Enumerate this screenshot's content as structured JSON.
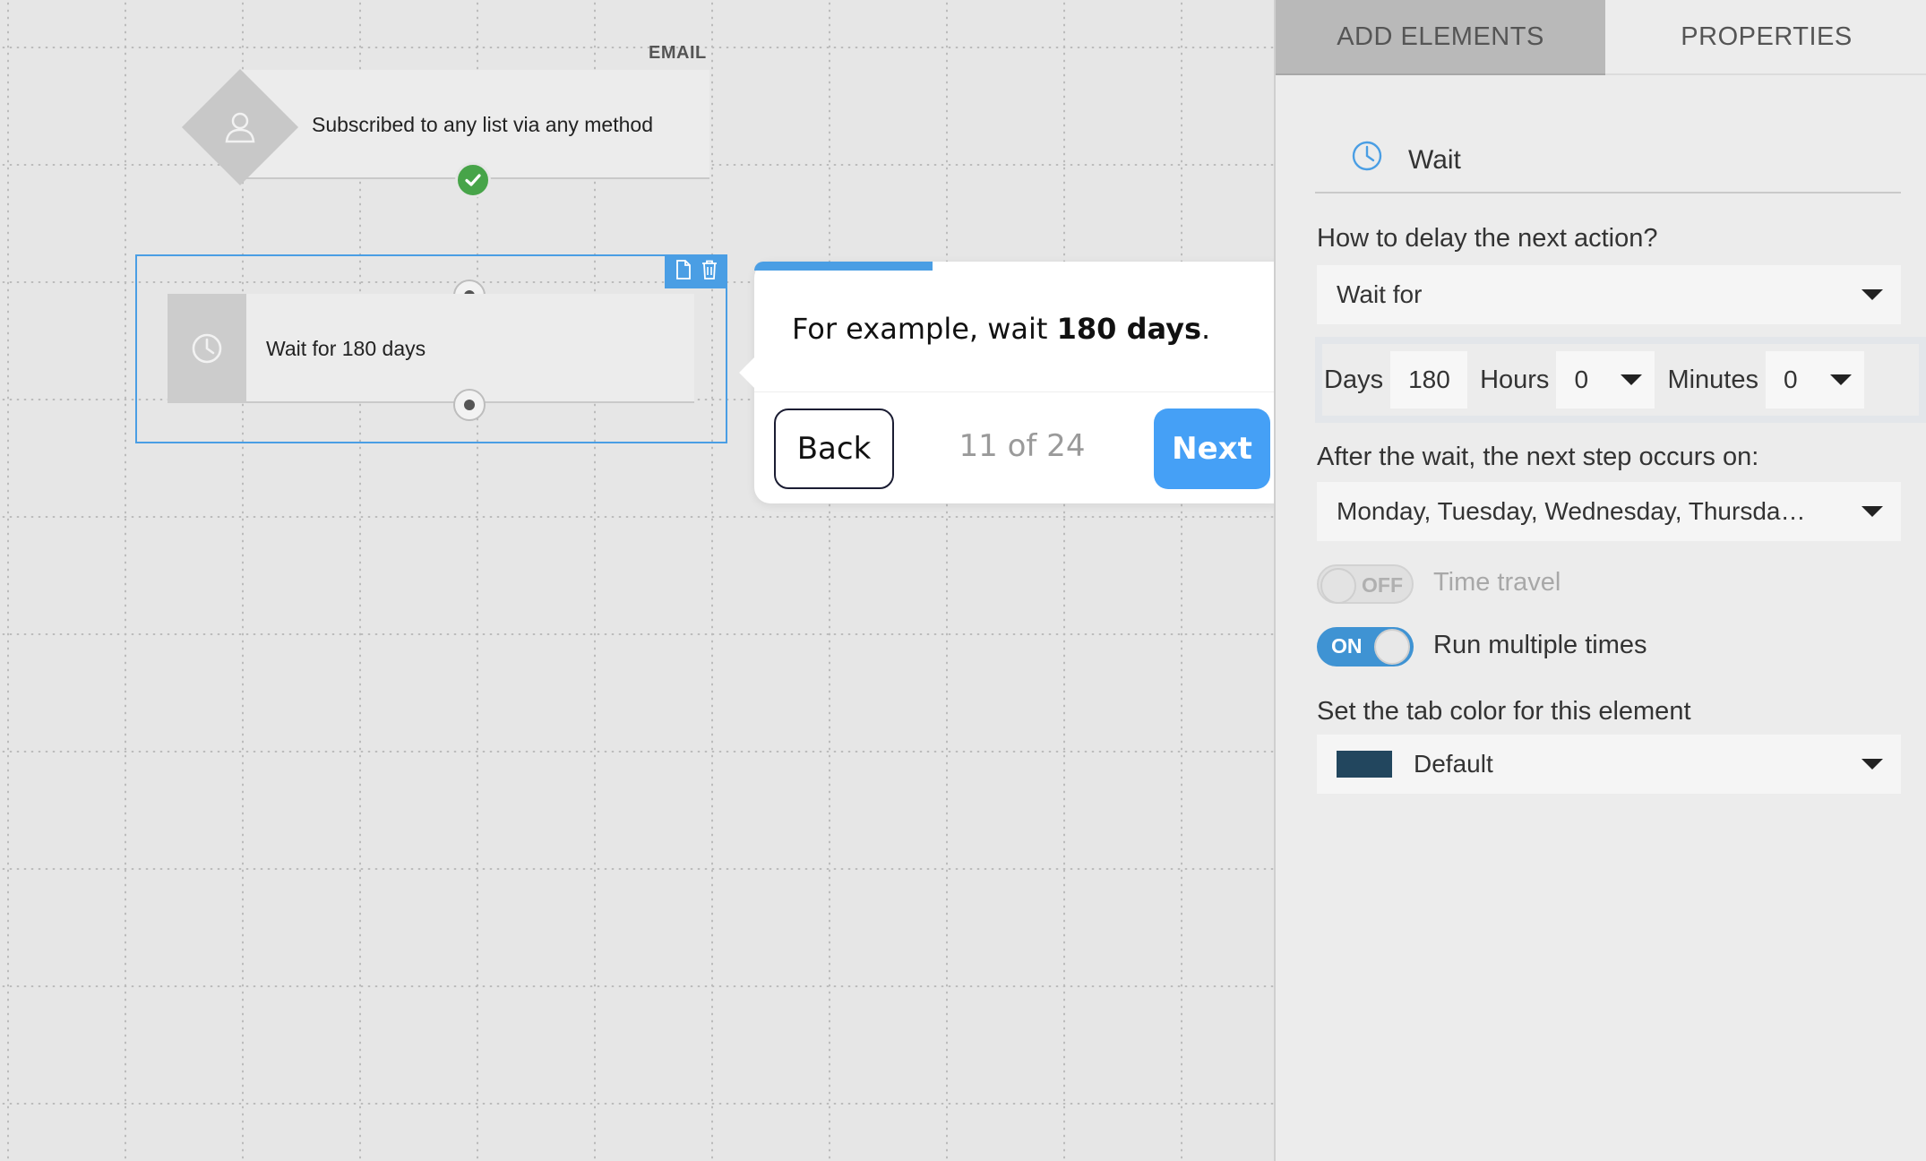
{
  "canvas": {
    "trigger": {
      "channel_label": "EMAIL",
      "text": "Subscribed to any list via any method",
      "icon": "user-icon",
      "status_icon": "check-circle-icon"
    },
    "wait_node": {
      "text": "Wait for 180 days",
      "icon": "clock-icon",
      "tools": [
        "copy-icon",
        "trash-icon"
      ]
    }
  },
  "tour": {
    "message_prefix": "For example, wait ",
    "message_bold": "180 days",
    "message_suffix": ".",
    "back_label": "Back",
    "counter": "11 of 24",
    "next_label": "Next",
    "progress_fraction": 0.333
  },
  "panel": {
    "tabs": [
      {
        "label": "ADD ELEMENTS",
        "active": false
      },
      {
        "label": "PROPERTIES",
        "active": true
      }
    ],
    "header": {
      "title": "Wait",
      "icon": "clock-icon"
    },
    "delay_question": "How to delay the next action?",
    "delay_mode": "Wait for",
    "days_label": "Days",
    "days_value": "180",
    "hours_label": "Hours",
    "hours_value": "0",
    "minutes_label": "Minutes",
    "minutes_value": "0",
    "after_wait_label": "After the wait, the next step occurs on:",
    "after_wait_value": "Monday, Tuesday, Wednesday, Thursda…",
    "time_travel": {
      "state": "OFF",
      "label": "Time travel"
    },
    "run_multiple": {
      "state": "ON",
      "label": "Run multiple times"
    },
    "tab_color_label": "Set the tab color for this element",
    "tab_color_value": "Default",
    "tab_color_swatch": "#22465e"
  },
  "colors": {
    "accent": "#4a9ee4",
    "next_button": "#45a0f6",
    "success": "#47a449",
    "toggle_on": "#3f93d3"
  }
}
